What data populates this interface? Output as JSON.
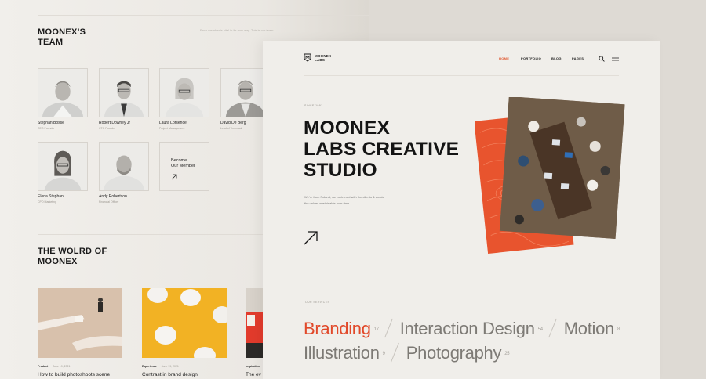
{
  "team": {
    "title_line1": "MOONEX'S",
    "title_line2": "TEAM",
    "note": "Each member is vital in its own way. This is our team.",
    "members": [
      {
        "name": "Stephan Bosse",
        "role": "CEO Founder"
      },
      {
        "name": "Robert Downey Jr",
        "role": "CTO Founder"
      },
      {
        "name": "Laura Lorsence",
        "role": "Project Management"
      },
      {
        "name": "David De Berg",
        "role": "Lead of Technical"
      },
      {
        "name": "Elena Stephan",
        "role": "CPO Marketing"
      },
      {
        "name": "Andy Robertson",
        "role": "Financial Officer"
      }
    ],
    "become_line1": "Become",
    "become_line2": "Our Member"
  },
  "world": {
    "title_line1": "THE WOLRD OF",
    "title_line2": "MOONEX",
    "posts": [
      {
        "category": "Product",
        "date": "June 19, 2021",
        "title": "How to build photoshoots scene"
      },
      {
        "category": "Experience",
        "date": "June 19, 2021",
        "title": "Contrast in brand design"
      },
      {
        "category": "Inspiration",
        "date": "",
        "title": "The ev"
      }
    ]
  },
  "brand": {
    "line1": "MOONEX",
    "line2": "LABS",
    "accent": "#e0572f"
  },
  "nav": {
    "items": [
      "HOME",
      "PORTFOLIO",
      "BLOG",
      "PAGES"
    ],
    "active": "HOME"
  },
  "hero": {
    "since": "SINCE 1991",
    "title_line1": "MOONEX",
    "title_line2": "LABS CREATIVE",
    "title_line3": "STUDIO",
    "sub_line1": "We're from Poland, we partnered with the clients & create",
    "sub_line2": "the values sustainable over time"
  },
  "services": {
    "label": "OUR SERVICES",
    "items": [
      {
        "name": "Branding",
        "count": "17"
      },
      {
        "name": "Interaction Design",
        "count": "54"
      },
      {
        "name": "Motion",
        "count": "8"
      },
      {
        "name": "Illustration",
        "count": "9"
      },
      {
        "name": "Photography",
        "count": "25"
      }
    ]
  },
  "icons": [
    "shield-logo-icon",
    "search-icon",
    "menu-icon",
    "arrow-up-right-icon"
  ]
}
